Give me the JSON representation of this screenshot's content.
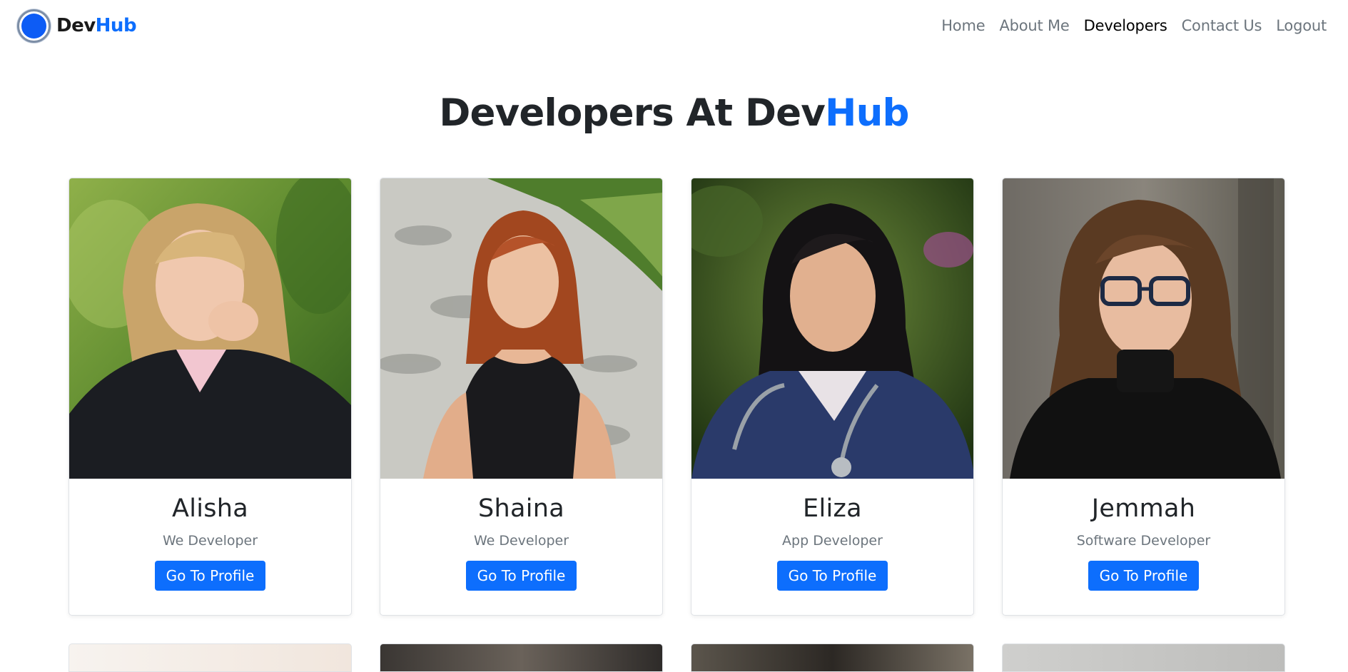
{
  "nav": {
    "brand_dev": "Dev",
    "brand_hub": "Hub",
    "links": [
      {
        "label": "Home"
      },
      {
        "label": "About Me"
      },
      {
        "label": "Developers"
      },
      {
        "label": "Contact Us"
      },
      {
        "label": "Logout"
      }
    ],
    "active": "Developers"
  },
  "heading": {
    "prefix": "Developers At Dev",
    "highlight": "Hub"
  },
  "developers": [
    {
      "name": "Alisha",
      "role": "We Developer",
      "button": "Go To Profile"
    },
    {
      "name": "Shaina",
      "role": "We Developer",
      "button": "Go To Profile"
    },
    {
      "name": "Eliza",
      "role": "App Developer",
      "button": "Go To Profile"
    },
    {
      "name": "Jemmah",
      "role": "Software Developer",
      "button": "Go To Profile"
    }
  ],
  "colors": {
    "accent": "#0d6efd",
    "text": "#212529",
    "muted": "#6c757d"
  }
}
